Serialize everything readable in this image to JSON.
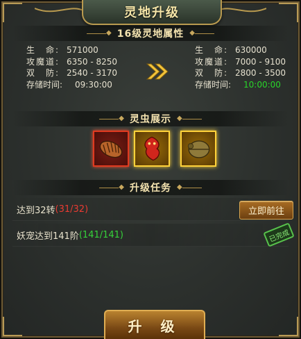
{
  "window": {
    "title": "灵地升级"
  },
  "attributes": {
    "section_title": "16级灵地属性",
    "current": {
      "hp_label": "生　命:",
      "hp": "571000",
      "attack_label": "攻魔道:",
      "attack": "6350 - 8250",
      "defense_label": "双　防:",
      "defense": "2540 - 3170",
      "storage_label": "存储时间:",
      "storage": "09:30:00"
    },
    "next": {
      "hp_label": "生　命:",
      "hp": "630000",
      "attack_label": "攻魔道:",
      "attack": "7000 - 9100",
      "defense_label": "双　防:",
      "defense": "2800 - 3500",
      "storage_label": "存储时间:",
      "storage": "10:00:00"
    }
  },
  "bugs": {
    "section_title": "灵虫展示",
    "items": [
      "larva-bug-icon",
      "red-dragon-bug-icon",
      "golden-beetle-icon"
    ]
  },
  "tasks": {
    "section_title": "升级任务",
    "items": [
      {
        "label": "达到32转",
        "progress": "(31/32)",
        "status": "incomplete",
        "action_label": "立即前往"
      },
      {
        "label": "妖宠达到141阶",
        "progress": "(141/141)",
        "status": "complete",
        "stamp_label": "已完成"
      }
    ]
  },
  "footer": {
    "upgrade_label": "升 级"
  },
  "colors": {
    "gold": "#f4e3b0",
    "green": "#29d62a",
    "red": "#ea3b32"
  }
}
